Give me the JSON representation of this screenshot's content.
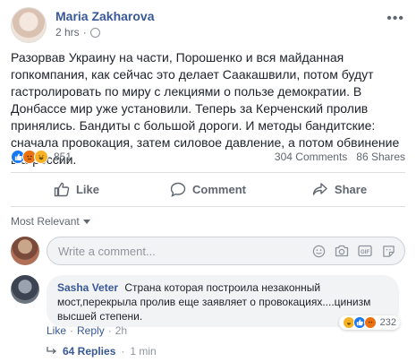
{
  "post": {
    "author": "Maria Zakharova",
    "timestamp": "2 hrs",
    "more_icon": "more-horizontal-icon",
    "text": "Разорвав Украину на части, Порошенко и вся майданная гопкомпания, как сейчас это делает Саакашвили, потом будут гастролировать по миру с лекциями о пользе демократии. В Донбассе мир уже установили. Теперь за Керченский пролив принялись. Бандиты с большой дороги. И методы бандитские: сначала провокация, затем силовое давление, а потом обвинение в агрессии."
  },
  "reactions": {
    "types": [
      "like",
      "angry",
      "haha"
    ],
    "count": "851",
    "comments_count": "304 Comments",
    "shares_count": "86 Shares"
  },
  "actions": {
    "like_label": "Like",
    "comment_label": "Comment",
    "share_label": "Share"
  },
  "comments_section": {
    "sort_label": "Most Relevant",
    "composer_placeholder": "Write a comment...",
    "composer_icons": [
      "emoji-icon",
      "camera-icon",
      "gif-icon",
      "sticker-icon"
    ]
  },
  "comment": {
    "author": "Sasha Veter",
    "text": "Страна которая построила незаконный мост,перекрыла пролив еще заявляет о провокациях....цинизм высшей степени.",
    "reactions_count": "232",
    "like_label": "Like",
    "reply_label": "Reply",
    "time": "2h",
    "replies_label": "64 Replies",
    "replies_time": "1 min"
  },
  "colors": {
    "link_blue": "#385898",
    "like_blue": "#1877f2",
    "angry_orange": "#e9710f",
    "haha_yellow": "#f7b125",
    "muted_text": "#606770"
  }
}
